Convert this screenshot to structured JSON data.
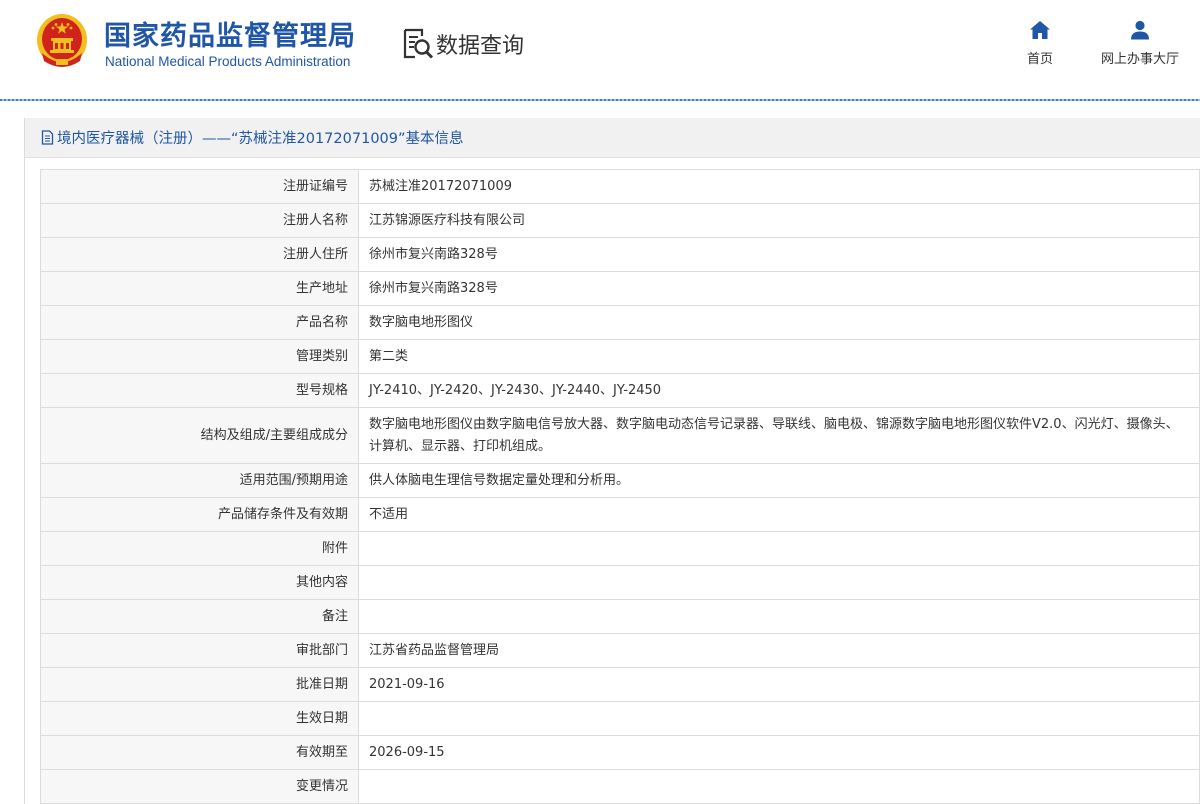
{
  "header": {
    "brand_cn": "国家药品监督管理局",
    "brand_en": "National Medical Products Administration",
    "query_label": "数据查询",
    "nav": {
      "home_label": "首页",
      "service_label": "网上办事大厅"
    },
    "icons": {
      "emblem": "national-emblem-icon",
      "query": "document-search-icon",
      "home": "home-icon",
      "service": "user-icon"
    },
    "colors": {
      "brand_blue": "#1f56a5",
      "emblem_red": "#d0231c",
      "emblem_gold": "#f2c01e"
    }
  },
  "panel": {
    "title": "境内医疗器械（注册）——“苏械注准20172071009”基本信息",
    "title_icon": "document-icon"
  },
  "table": {
    "rows": [
      {
        "label": "注册证编号",
        "value": "苏械注准20172071009"
      },
      {
        "label": "注册人名称",
        "value": "江苏锦源医疗科技有限公司"
      },
      {
        "label": "注册人住所",
        "value": "徐州市复兴南路328号"
      },
      {
        "label": "生产地址",
        "value": "徐州市复兴南路328号"
      },
      {
        "label": "产品名称",
        "value": "数字脑电地形图仪"
      },
      {
        "label": "管理类别",
        "value": "第二类"
      },
      {
        "label": "型号规格",
        "value": "JY-2410、JY-2420、JY-2430、JY-2440、JY-2450"
      },
      {
        "label": "结构及组成/主要组成成分",
        "value": "数字脑电地形图仪由数字脑电信号放大器、数字脑电动态信号记录器、导联线、脑电极、锦源数字脑电地形图仪软件V2.0、闪光灯、摄像头、计算机、显示器、打印机组成。"
      },
      {
        "label": "适用范围/预期用途",
        "value": "供人体脑电生理信号数据定量处理和分析用。"
      },
      {
        "label": "产品储存条件及有效期",
        "value": "不适用"
      },
      {
        "label": "附件",
        "value": ""
      },
      {
        "label": "其他内容",
        "value": ""
      },
      {
        "label": "备注",
        "value": ""
      },
      {
        "label": "审批部门",
        "value": "江苏省药品监督管理局"
      },
      {
        "label": "批准日期",
        "value": "2021-09-16"
      },
      {
        "label": "生效日期",
        "value": ""
      },
      {
        "label": "有效期至",
        "value": "2026-09-15"
      },
      {
        "label": "变更情况",
        "value": ""
      }
    ]
  }
}
